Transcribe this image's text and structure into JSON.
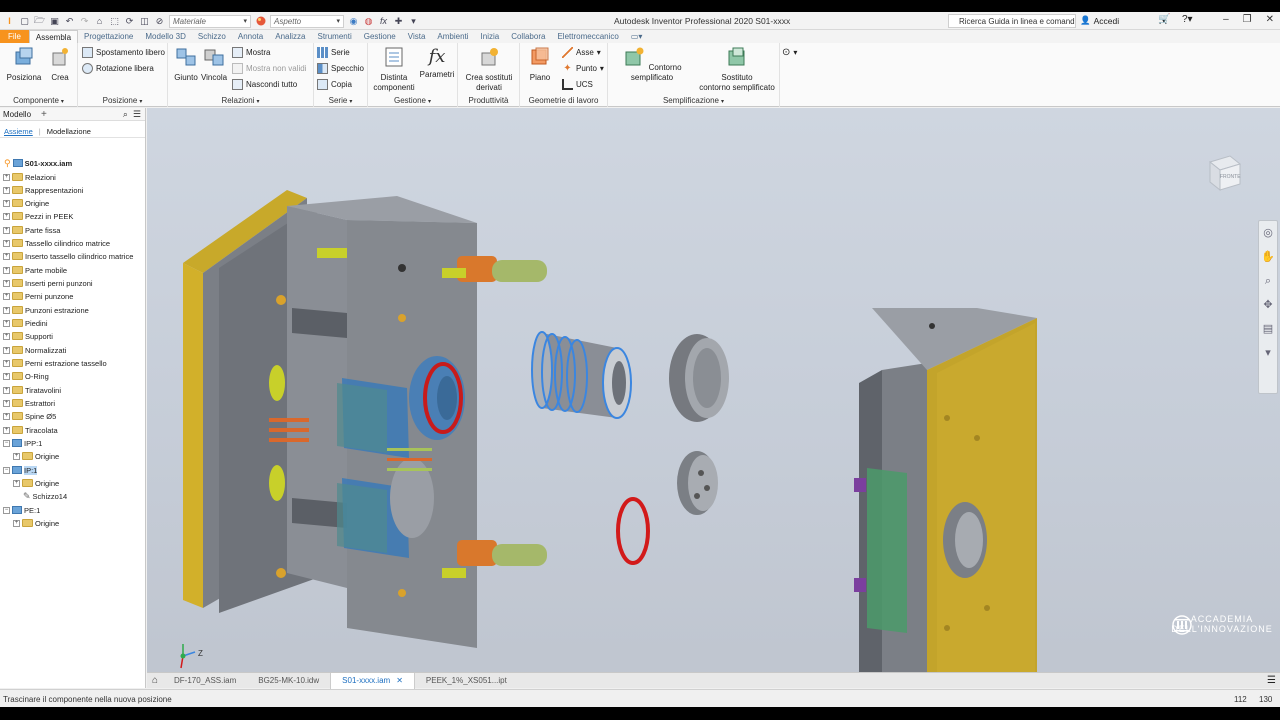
{
  "window": {
    "title": "Autodesk Inventor Professional 2020   S01-xxxx",
    "search_placeholder": "Ricerca Guida in linea e comand",
    "sign_in": "Accedi"
  },
  "qat": {
    "material": "Materiale",
    "appearance": "Aspetto"
  },
  "tabs": [
    "File",
    "Assembla",
    "Progettazione",
    "Modello 3D",
    "Schizzo",
    "Annota",
    "Analizza",
    "Strumenti",
    "Gestione",
    "Vista",
    "Ambienti",
    "Inizia",
    "Collabora",
    "Elettromeccanico"
  ],
  "active_tab": "Assembla",
  "ribbon": {
    "componente": {
      "title": "Componente",
      "posiziona": "Posiziona",
      "crea": "Crea"
    },
    "posizione": {
      "title": "Posizione",
      "spostamento": "Spostamento libero",
      "rotazione": "Rotazione libera"
    },
    "relazioni": {
      "title": "Relazioni",
      "giunto": "Giunto",
      "vincola": "Vincola",
      "mostra": "Mostra",
      "mostra_non_validi": "Mostra non validi",
      "nascondi_tutto": "Nascondi tutto"
    },
    "serie": {
      "title": "Serie",
      "serie": "Serie",
      "specchio": "Specchio",
      "copia": "Copia"
    },
    "gestione": {
      "title": "Gestione",
      "distinta_1": "Distinta",
      "distinta_2": "componenti",
      "parametri": "Parametri"
    },
    "produttivita": {
      "title": "Produttività",
      "crea_sost_1": "Crea sostituti",
      "crea_sost_2": "derivati"
    },
    "geometrie": {
      "title": "Geometrie di lavoro",
      "piano": "Piano",
      "asse": "Asse",
      "punto": "Punto",
      "ucs": "UCS"
    },
    "semplificazione": {
      "title": "Semplificazione",
      "contorno": "Contorno semplificato",
      "sostituto_1": "Sostituto",
      "sostituto_2": "contorno semplificato"
    }
  },
  "browser": {
    "header": "Modello",
    "tab_assieme": "Assieme",
    "tab_modellazione": "Modellazione",
    "root": "S01-xxxx.iam",
    "items": [
      "Relazioni",
      "Rappresentazioni",
      "Origine",
      "Pezzi in PEEK",
      "Parte fissa",
      "Tassello cilindrico matrice",
      "Inserto tassello cilindrico matrice",
      "Parte mobile",
      "Inserti perni punzoni",
      "Perni punzone",
      "Punzoni estrazione",
      "Piedini",
      "Supporti",
      "Normalizzati",
      "Perni estrazione tassello",
      "O-Ring",
      "Tiratavolini",
      "Estrattori",
      "Spine Ø5",
      "Tiracolata"
    ],
    "ipp": "IPP:1",
    "ipp_origin": "Origine",
    "ip": "IP:1",
    "ip_origin": "Origine",
    "ip_sketch": "Schizzo14",
    "pe": "PE:1",
    "pe_origin": "Origine"
  },
  "viewport": {
    "viewcube_label": "FRONTE",
    "logo_line1": "ACCADEMIA",
    "logo_line2": "DELL'INNOVAZIONE",
    "axis_z": "Z"
  },
  "doc_tabs": [
    "DF-170_ASS.iam",
    "BG25-MK-10.idw",
    "S01-xxxx.iam",
    "PEEK_1%_XS051...ipt"
  ],
  "active_doc": "S01-xxxx.iam",
  "status": {
    "message": "Trascinare il componente nella nuova posizione",
    "num1": "112",
    "num2": "130"
  }
}
